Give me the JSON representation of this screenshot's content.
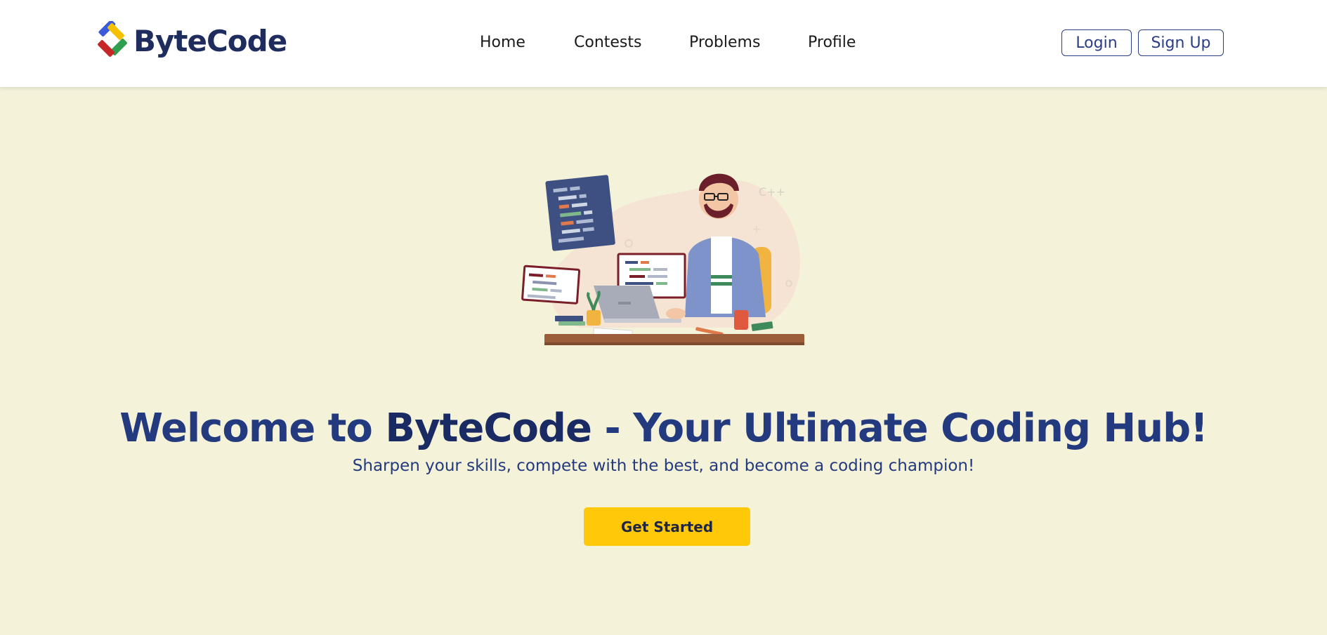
{
  "brand": {
    "name": "ByteCode",
    "logo_icon": "diamond-logo-icon"
  },
  "nav": {
    "links": [
      {
        "label": "Home"
      },
      {
        "label": "Contests"
      },
      {
        "label": "Problems"
      },
      {
        "label": "Profile"
      }
    ],
    "login_label": "Login",
    "signup_label": "Sign Up"
  },
  "hero": {
    "illustration": "developer-at-desk-illustration",
    "illustration_tag": "C++",
    "headline_prefix": "Welcome to ",
    "headline_brand": "ByteCode",
    "headline_suffix": " - Your Ultimate Coding Hub!",
    "subtitle": "Sharpen your skills, compete with the best, and become a coding champion!",
    "cta_label": "Get Started"
  },
  "colors": {
    "page_background": "#F4F2D9",
    "navbar_background": "#FFFFFF",
    "heading": "#243A7E",
    "accent_button": "#FFC90A",
    "outline_button": "#2A3D87"
  }
}
